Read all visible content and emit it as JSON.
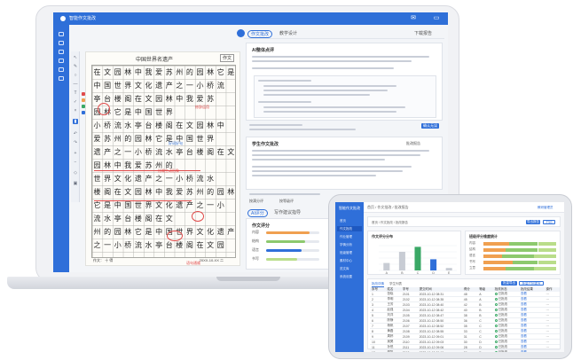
{
  "brand": {
    "laptop_app_name": "智能作文批改",
    "tablet_app_name": "智能作文批改"
  },
  "colors": {
    "primary": "#2f6fd9",
    "annotation_red": "#e04a4a",
    "chart_gray": "#c8ccd4",
    "chart_green": "#3aa866",
    "chart_blue": "#2f6fd9",
    "bar_orange": "#f0a050",
    "bar_green": "#8dc96e",
    "bar_lightgreen": "#b9dd8a"
  },
  "laptop": {
    "paper_title": "中国世界名遗产",
    "paper_stamp": "作文",
    "paper_foot_left": "作文：  十   得",
    "paper_foot_right": "20XX-10-XX  二",
    "essay_glyphs": [
      "在",
      "文",
      "园",
      "林",
      "中",
      "我",
      "爱",
      "苏",
      "州",
      "的",
      "园",
      "林",
      "它",
      "是",
      "中",
      "国",
      "世",
      "界",
      "文",
      "化",
      "遗",
      "产",
      "之",
      "一",
      "小",
      "桥",
      "流",
      "水",
      "亭",
      "台",
      "楼",
      "阁"
    ],
    "red_notes": [
      "比喻生动形象",
      "修辞运用",
      "语句通顺"
    ],
    "blue_notes": [
      "好词好句"
    ],
    "tabs": [
      "作文批改",
      "教学设计"
    ],
    "tab_right": "下载报告",
    "card1_title": "AI整体点评",
    "card2_title": "学生作文批改",
    "card2_right": "批改报告",
    "card3_title": "作文评分",
    "score_tabs": [
      "AI评分",
      "写作建议指导"
    ],
    "score_labels": [
      "内容",
      "结构",
      "语言",
      "书写"
    ],
    "score_values": [
      0.82,
      0.74,
      0.66,
      0.58
    ],
    "confirm_btn": "确认无误",
    "radio_a": "按满分评",
    "radio_b": "按等级评"
  },
  "tablet": {
    "crumb": "首页 / 作文批改 / 批改报告",
    "user": "教研管理员",
    "stats_title": "作文评分分布",
    "rank_title": "班级评分维度统计",
    "export_btn": "导出报告",
    "print_btn": "打印",
    "nav_items": [
      "首页",
      "作文批改",
      "作业管理",
      "学情分析",
      "班级管理",
      "素材中心",
      "范文库",
      "系统设置"
    ],
    "table_tabs": [
      "批改详情",
      "学生列表"
    ],
    "table_buttons": [
      "批量导出",
      "批量打回重写"
    ],
    "table_headers": [
      "序号",
      "姓名",
      "学号",
      "提交时间",
      "得分",
      "等级",
      "批改状态",
      "批改结果",
      "操作"
    ],
    "table_rows": [
      [
        "1",
        "张晓",
        "2101",
        "2023-10-12 08:31",
        "48",
        "A",
        "已批改",
        "查看",
        "···"
      ],
      [
        "2",
        "李明",
        "2102",
        "2023-10-12 08:35",
        "45",
        "A",
        "已批改",
        "查看",
        "···"
      ],
      [
        "3",
        "王芳",
        "2103",
        "2023-10-12 08:40",
        "42",
        "B",
        "已批改",
        "查看",
        "···"
      ],
      [
        "4",
        "赵强",
        "2104",
        "2023-10-12 08:42",
        "40",
        "B",
        "已批改",
        "查看",
        "···"
      ],
      [
        "5",
        "刘洋",
        "2105",
        "2023-10-12 08:47",
        "38",
        "B",
        "已批改",
        "查看",
        "···"
      ],
      [
        "6",
        "陈静",
        "2106",
        "2023-10-12 08:50",
        "36",
        "C",
        "已批改",
        "查看",
        "···"
      ],
      [
        "7",
        "杨帆",
        "2107",
        "2023-10-12 08:52",
        "35",
        "C",
        "已批改",
        "查看",
        "···"
      ],
      [
        "8",
        "黄磊",
        "2108",
        "2023-10-12 08:55",
        "33",
        "C",
        "已批改",
        "查看",
        "···"
      ],
      [
        "9",
        "周婷",
        "2109",
        "2023-10-12 09:01",
        "31",
        "C",
        "已批改",
        "查看",
        "···"
      ],
      [
        "10",
        "吴昊",
        "2110",
        "2023-10-12 09:03",
        "30",
        "D",
        "已批改",
        "查看",
        "···"
      ],
      [
        "11",
        "孙悦",
        "2111",
        "2023-10-12 09:06",
        "28",
        "D",
        "已批改",
        "查看",
        "···"
      ],
      [
        "12",
        "郑凯",
        "2112",
        "2023-10-12 09:10",
        "26",
        "D",
        "已批改",
        "查看",
        "···"
      ]
    ],
    "hbar_labels": [
      "内容",
      "结构",
      "语言",
      "书写",
      "立意"
    ],
    "hbar_segments": [
      [
        0.35,
        0.4,
        0.25
      ],
      [
        0.3,
        0.45,
        0.25
      ],
      [
        0.25,
        0.45,
        0.3
      ],
      [
        0.4,
        0.35,
        0.25
      ],
      [
        0.3,
        0.4,
        0.3
      ]
    ]
  },
  "chart_data": {
    "type": "bar",
    "categories": [
      "A",
      "B",
      "C",
      "D",
      "E"
    ],
    "series": [
      {
        "values": [
          12,
          30,
          38,
          18,
          4
        ]
      }
    ],
    "ylim": [
      0,
      40
    ],
    "grid": true
  }
}
